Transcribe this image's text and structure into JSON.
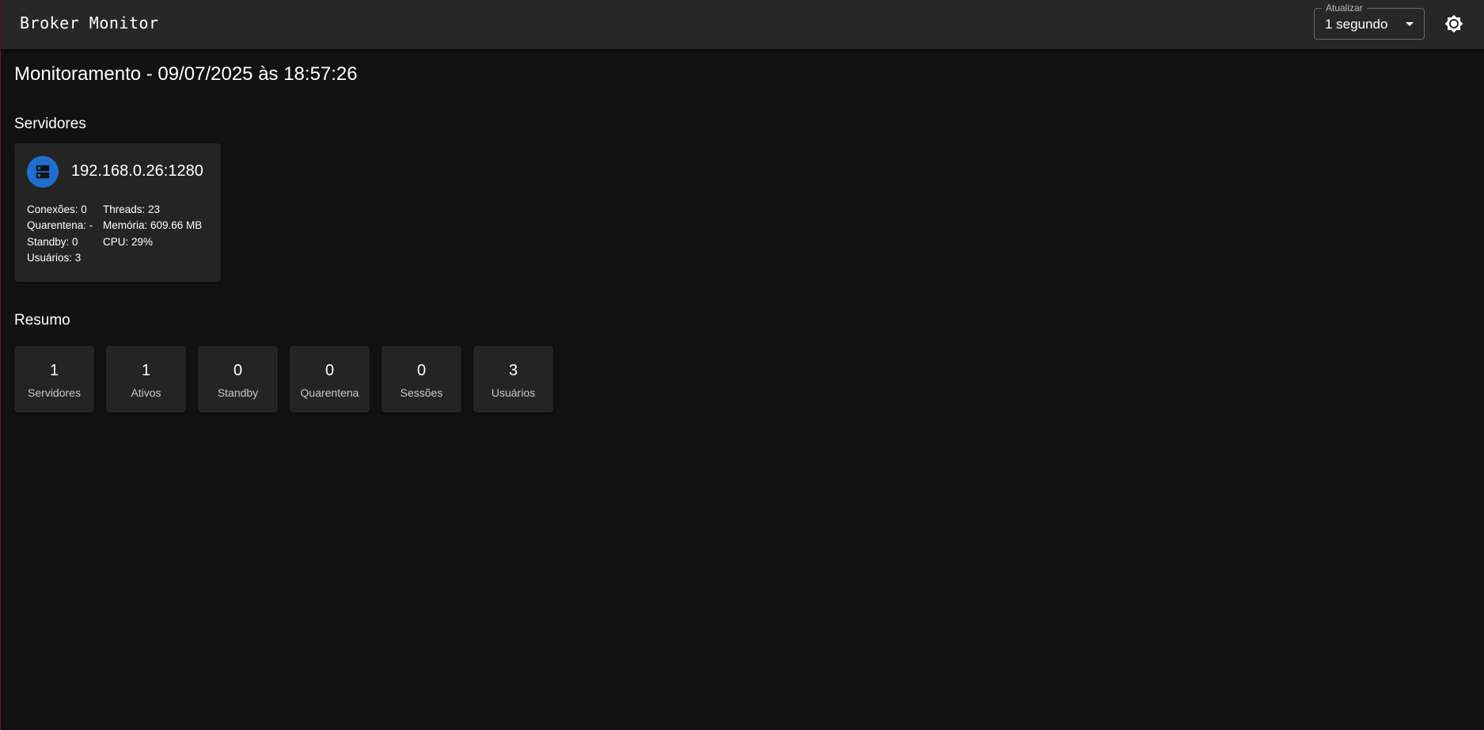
{
  "header": {
    "title": "Broker Monitor",
    "refresh": {
      "label": "Atualizar",
      "value": "1 segundo"
    },
    "theme_icon": "brightness-icon"
  },
  "main": {
    "title": "Monitoramento - 09/07/2025 às 18:57:26",
    "servers_title": "Servidores",
    "summary_title": "Resumo"
  },
  "servers": [
    {
      "icon": "dns-server-icon",
      "address": "192.168.0.26:1280",
      "stats_left": [
        "Conexões: 0",
        "Quarentena: -",
        "Standby: 0",
        "Usuários: 3"
      ],
      "stats_right": [
        "Threads: 23",
        "Memória: 609.66 MB",
        "CPU: 29%"
      ]
    }
  ],
  "summary": [
    {
      "value": "1",
      "label": "Servidores"
    },
    {
      "value": "1",
      "label": "Ativos"
    },
    {
      "value": "0",
      "label": "Standby"
    },
    {
      "value": "0",
      "label": "Quarentena"
    },
    {
      "value": "0",
      "label": "Sessões"
    },
    {
      "value": "3",
      "label": "Usuários"
    }
  ],
  "colors": {
    "background": "#121212",
    "appbar": "#272727",
    "card": "#242424",
    "accent": "#1f6fd1"
  }
}
